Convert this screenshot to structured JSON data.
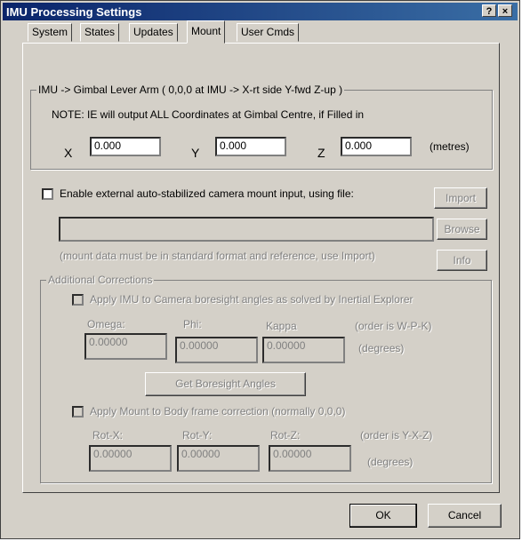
{
  "window": {
    "title": "IMU Processing Settings",
    "help_glyph": "?",
    "close_glyph": "×"
  },
  "tabs": [
    {
      "label": "System",
      "active": false
    },
    {
      "label": "States",
      "active": false
    },
    {
      "label": "Updates",
      "active": false
    },
    {
      "label": "Mount",
      "active": true
    },
    {
      "label": "User Cmds",
      "active": false
    }
  ],
  "lever_arm": {
    "group_label": "IMU -> Gimbal Lever Arm ( 0,0,0 at IMU -> X-rt side  Y-fwd  Z-up )",
    "note": "NOTE: IE will output ALL Coordinates at Gimbal Centre, if Filled in",
    "x_label": "X",
    "x_value": "0.000",
    "y_label": "Y",
    "y_value": "0.000",
    "z_label": "Z",
    "z_value": "0.000",
    "units": "(metres)"
  },
  "external_mount": {
    "enable_label": "Enable external auto-stabilized camera mount input, using file:",
    "enabled": false,
    "file_path": "",
    "import_label": "Import",
    "browse_label": "Browse",
    "info_label": "Info",
    "note": "(mount data must be in standard format and reference, use Import)"
  },
  "corrections": {
    "group_label": "Additional Corrections",
    "boresight_check_label": "Apply IMU to Camera boresight angles as solved by Inertial Explorer",
    "omega_label": "Omega:",
    "phi_label": "Phi:",
    "kappa_label": "Kappa",
    "order_label": "(order is W-P-K)",
    "omega_value": "0.00000",
    "phi_value": "0.00000",
    "kappa_value": "0.00000",
    "degrees_label": "(degrees)",
    "get_boresight_label": "Get Boresight Angles",
    "mount_check_label": "Apply Mount to Body frame correction (normally 0,0,0)",
    "rotx_label": "Rot-X:",
    "roty_label": "Rot-Y:",
    "rotz_label": "Rot-Z:",
    "rot_order_label": "(order is Y-X-Z)",
    "rotx_value": "0.00000",
    "roty_value": "0.00000",
    "rotz_value": "0.00000",
    "degrees_label2": "(degrees)"
  },
  "footer": {
    "ok_label": "OK",
    "cancel_label": "Cancel"
  }
}
